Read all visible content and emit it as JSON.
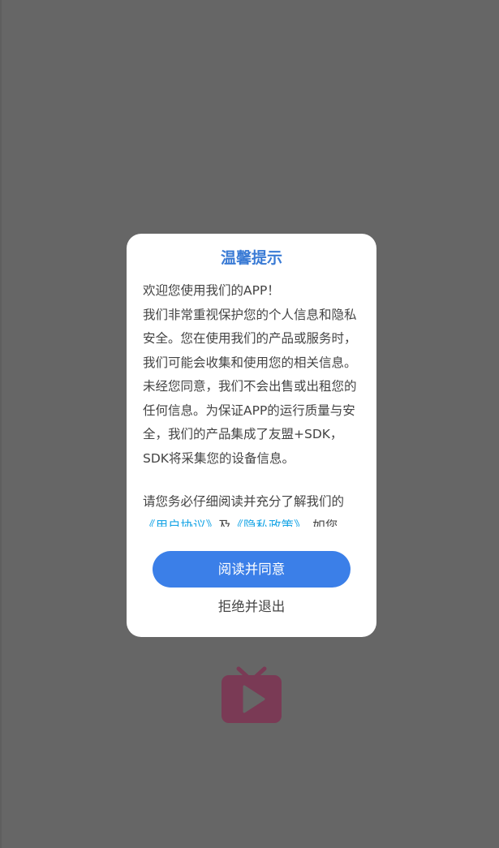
{
  "dialog": {
    "title": "温馨提示",
    "greeting": "欢迎您使用我们的APP！",
    "paragraph1": "我们非常重视保护您的个人信息和隐私安全。您在使用我们的产品或服务时，我们可能会收集和使用您的相关信息。未经您同意，我们不会出售或出租您的任何信息。为保证APP的运行质量与安全，我们的产品集成了友盟+SDK，SDK将采集您的设备信息。",
    "paragraph2_prefix": "请您务必仔细阅读并充分了解我们的",
    "user_agreement_link": "《用户协议》",
    "conjunction": "及",
    "privacy_policy_link": "《隐私政策》",
    "paragraph2_suffix": "，如您",
    "agree_label": "阅读并同意",
    "reject_label": "拒绝并退出"
  },
  "background": {
    "logo_icon": "tv-play-icon",
    "logo_color": "#7a3a55",
    "overlay_color": "#666666"
  },
  "colors": {
    "title": "#3a7bd5",
    "agree_button": "#3b7fe8",
    "link": "#1aa6e6"
  }
}
